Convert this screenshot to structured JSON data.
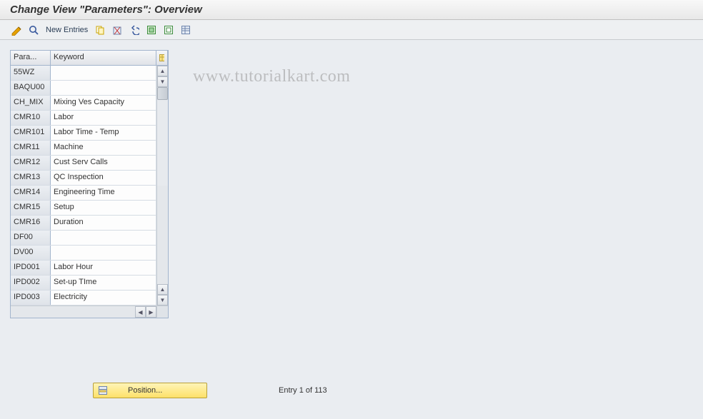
{
  "title": "Change View \"Parameters\": Overview",
  "toolbar": {
    "new_entries_label": "New Entries"
  },
  "table": {
    "headers": {
      "param": "Para...",
      "keyword": "Keyword"
    },
    "rows": [
      {
        "param": "55WZ",
        "keyword": ""
      },
      {
        "param": "BAQU00",
        "keyword": ""
      },
      {
        "param": "CH_MIX",
        "keyword": "Mixing Ves Capacity"
      },
      {
        "param": "CMR10",
        "keyword": "Labor"
      },
      {
        "param": "CMR101",
        "keyword": "Labor Time - Temp"
      },
      {
        "param": "CMR11",
        "keyword": "Machine"
      },
      {
        "param": "CMR12",
        "keyword": "Cust Serv Calls"
      },
      {
        "param": "CMR13",
        "keyword": "QC Inspection"
      },
      {
        "param": "CMR14",
        "keyword": "Engineering Time"
      },
      {
        "param": "CMR15",
        "keyword": "Setup"
      },
      {
        "param": "CMR16",
        "keyword": "Duration"
      },
      {
        "param": "DF00",
        "keyword": ""
      },
      {
        "param": "DV00",
        "keyword": ""
      },
      {
        "param": "IPD001",
        "keyword": "Labor Hour"
      },
      {
        "param": "IPD002",
        "keyword": "Set-up TIme"
      },
      {
        "param": "IPD003",
        "keyword": "Electricity"
      }
    ]
  },
  "footer": {
    "position_button": "Position...",
    "entry_status": "Entry 1 of 113"
  },
  "watermark": "www.tutorialkart.com"
}
